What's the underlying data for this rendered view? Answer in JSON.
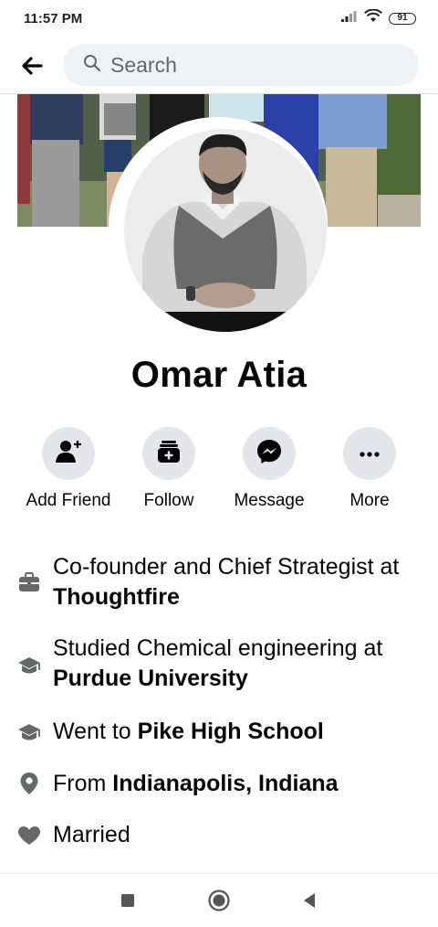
{
  "status_bar": {
    "time": "11:57 PM",
    "battery": "91",
    "icons": [
      "signal-icon",
      "wifi-icon",
      "battery-icon"
    ]
  },
  "header": {
    "back_icon": "arrow-left-icon",
    "search_placeholder": "Search",
    "search_icon": "search-icon"
  },
  "profile": {
    "name": "Omar Atia"
  },
  "actions": [
    {
      "label": "Add Friend",
      "icon": "add-friend-icon"
    },
    {
      "label": "Follow",
      "icon": "follow-icon"
    },
    {
      "label": "Message",
      "icon": "messenger-icon"
    },
    {
      "label": "More",
      "icon": "more-icon"
    }
  ],
  "info": {
    "work": {
      "prefix": "Co-founder and Chief Strategist at ",
      "bold": "Thoughtfire",
      "icon": "briefcase-icon"
    },
    "education_college": {
      "prefix": "Studied Chemical engineering at ",
      "bold": "Purdue University",
      "icon": "graduation-cap-icon"
    },
    "education_school": {
      "prefix": "Went to ",
      "bold": "Pike High School",
      "icon": "graduation-cap-icon"
    },
    "hometown": {
      "prefix": "From ",
      "bold": "Indianapolis, Indiana",
      "icon": "location-pin-icon"
    },
    "relationship": {
      "text": "Married",
      "icon": "heart-icon"
    }
  },
  "nav_bar": {
    "buttons": [
      "recent-apps-icon",
      "home-icon",
      "back-triangle-icon"
    ]
  },
  "colors": {
    "action_circle_bg": "#e4e6eb",
    "search_bg": "#f0f2f5",
    "icon_gray": "#65676b",
    "text": "#050505"
  }
}
